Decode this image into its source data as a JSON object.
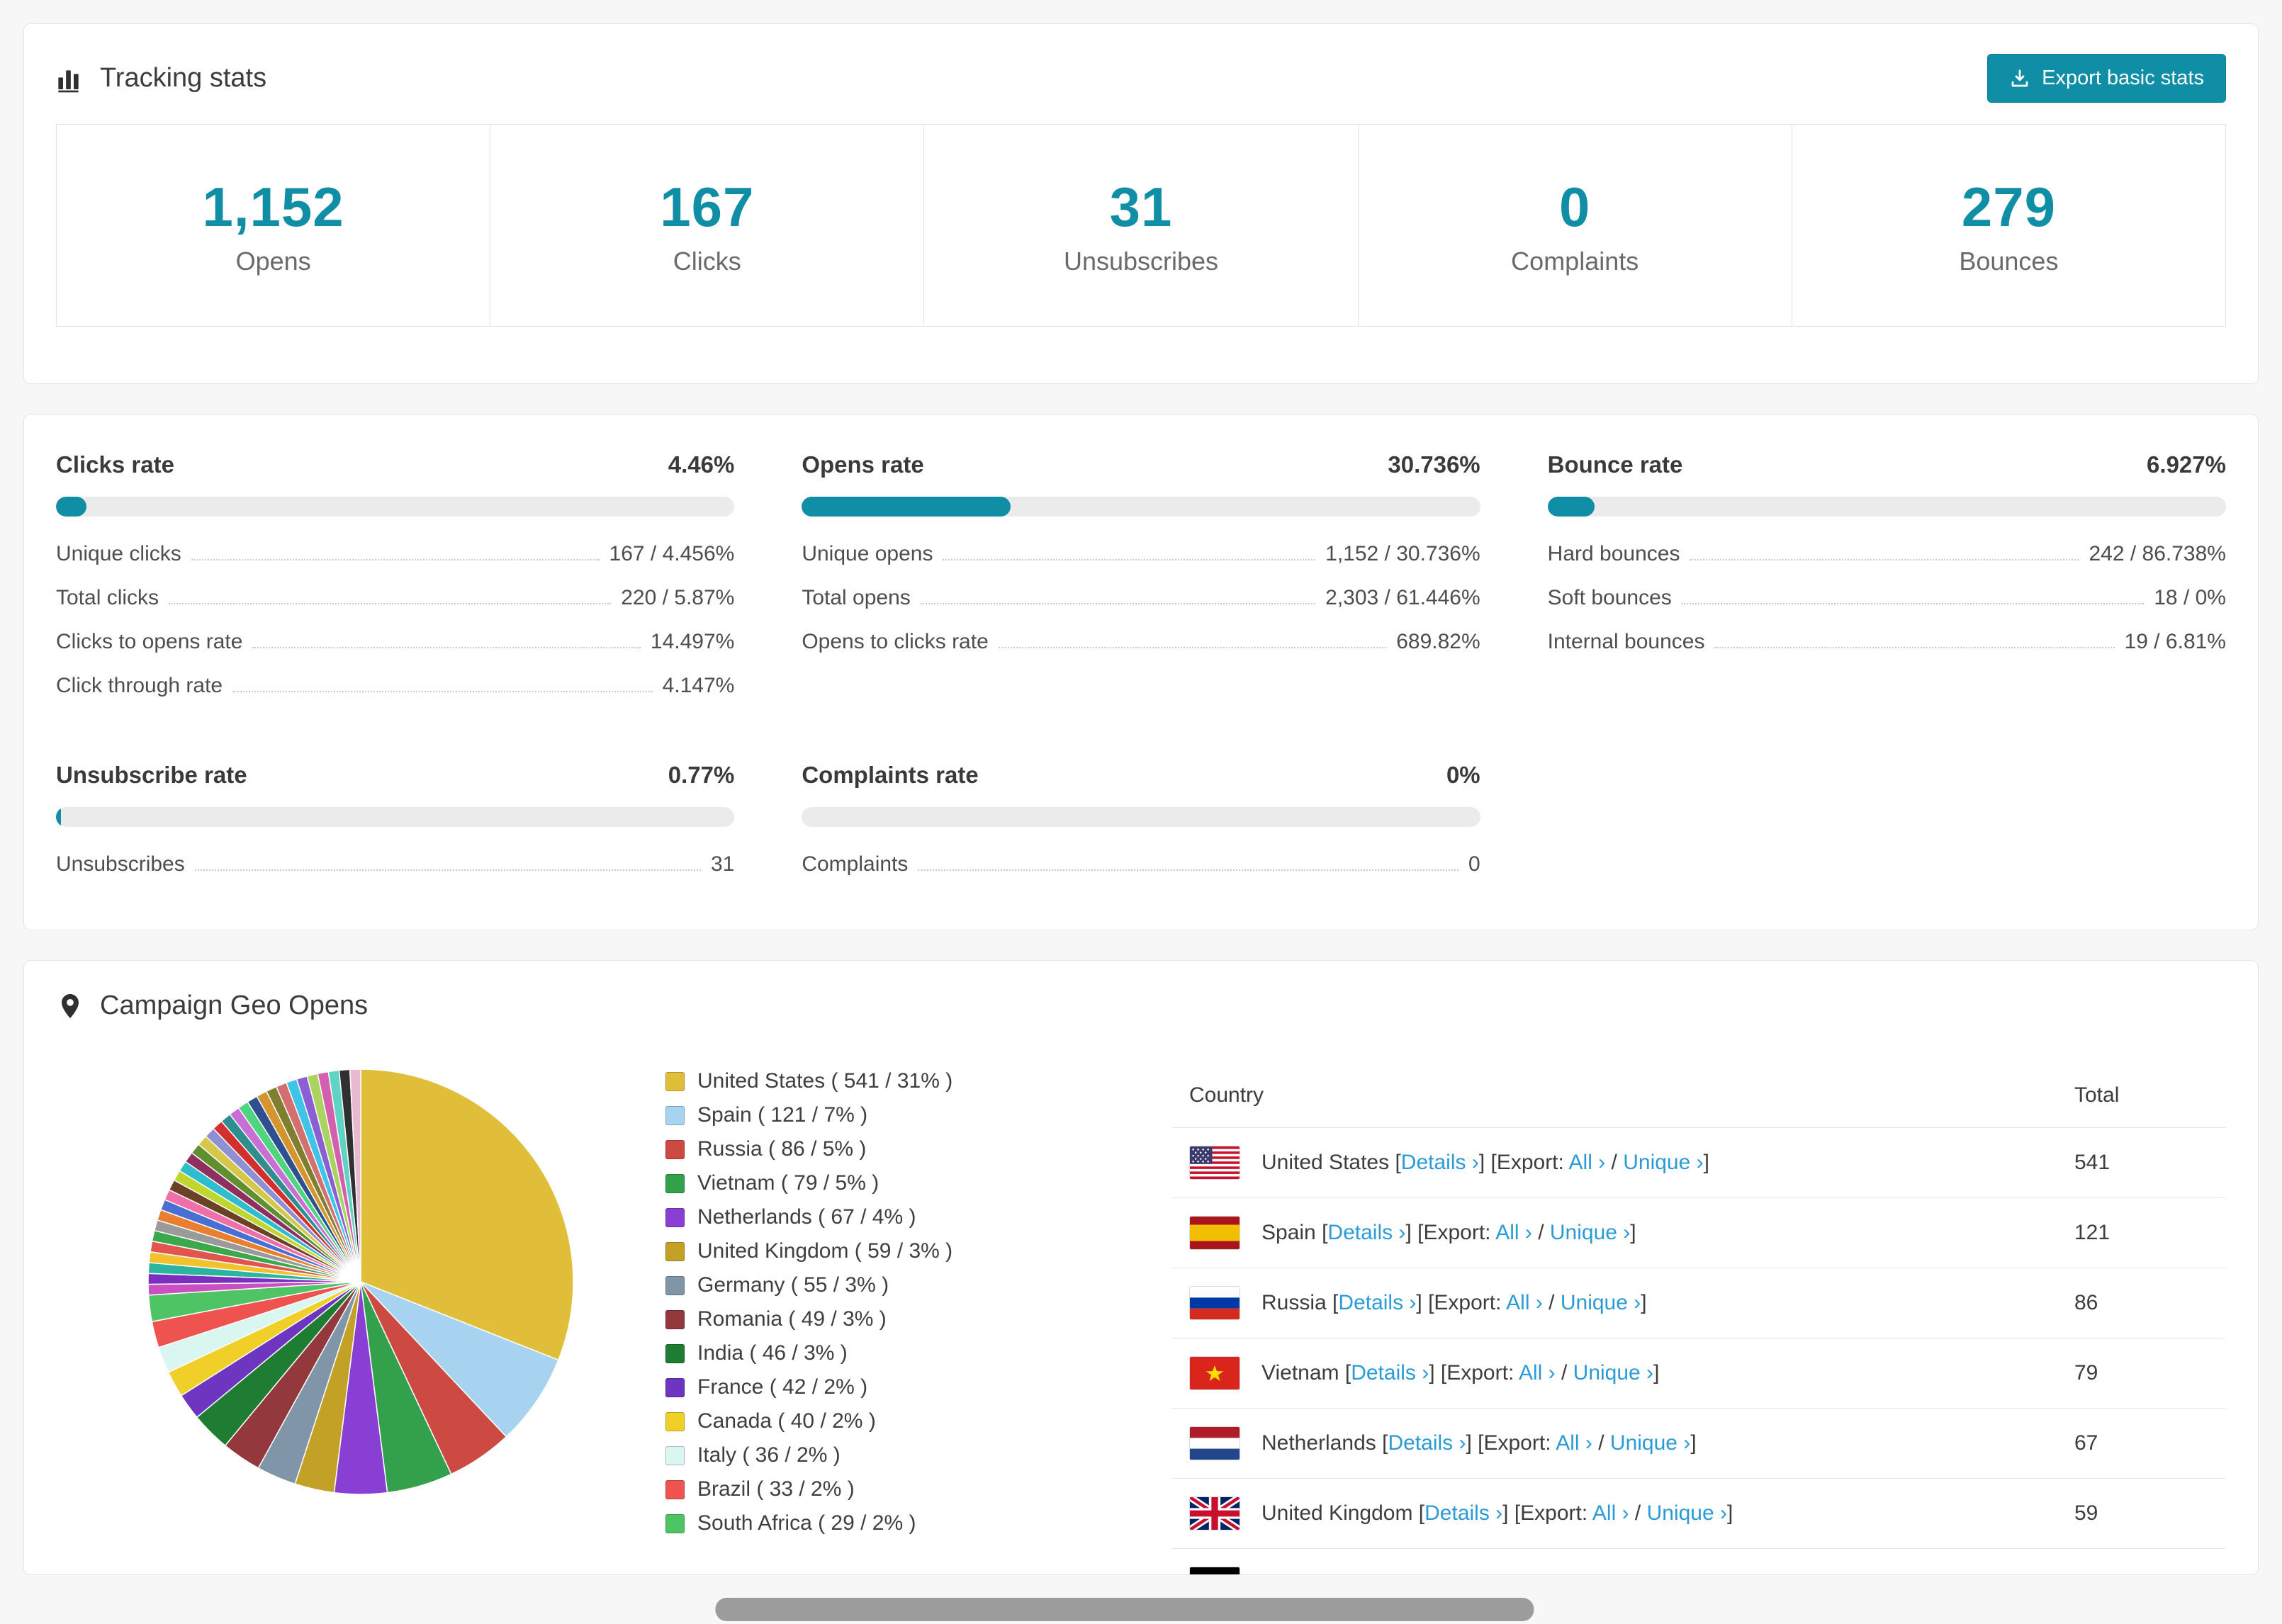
{
  "page": {
    "background": "#f7f7f7",
    "accent_color": "#0f8ea6",
    "link_color": "#2b9bd7"
  },
  "tracking": {
    "title": "Tracking stats",
    "export_button": "Export basic stats",
    "stats": [
      {
        "value": "1,152",
        "label": "Opens"
      },
      {
        "value": "167",
        "label": "Clicks"
      },
      {
        "value": "31",
        "label": "Unsubscribes"
      },
      {
        "value": "0",
        "label": "Complaints"
      },
      {
        "value": "279",
        "label": "Bounces"
      }
    ]
  },
  "rates": [
    {
      "title": "Clicks rate",
      "value": "4.46%",
      "pct": 4.46,
      "rows": [
        {
          "label": "Unique clicks",
          "value": "167 / 4.456%"
        },
        {
          "label": "Total clicks",
          "value": "220 / 5.87%"
        },
        {
          "label": "Clicks to opens rate",
          "value": "14.497%"
        },
        {
          "label": "Click through rate",
          "value": "4.147%"
        }
      ]
    },
    {
      "title": "Opens rate",
      "value": "30.736%",
      "pct": 30.736,
      "rows": [
        {
          "label": "Unique opens",
          "value": "1,152 / 30.736%"
        },
        {
          "label": "Total opens",
          "value": "2,303 / 61.446%"
        },
        {
          "label": "Opens to clicks rate",
          "value": "689.82%"
        }
      ]
    },
    {
      "title": "Bounce rate",
      "value": "6.927%",
      "pct": 6.927,
      "rows": [
        {
          "label": "Hard bounces",
          "value": "242 / 86.738%"
        },
        {
          "label": "Soft bounces",
          "value": "18 / 0%"
        },
        {
          "label": "Internal bounces",
          "value": "19 / 6.81%"
        }
      ]
    },
    {
      "title": "Unsubscribe rate",
      "value": "0.77%",
      "pct": 0.77,
      "rows": [
        {
          "label": "Unsubscribes",
          "value": "31"
        }
      ]
    },
    {
      "title": "Complaints rate",
      "value": "0%",
      "pct": 0,
      "rows": [
        {
          "label": "Complaints",
          "value": "0"
        }
      ]
    }
  ],
  "geo": {
    "title": "Campaign Geo Opens",
    "table": {
      "country_header": "Country",
      "total_header": "Total",
      "visible_rows": 7
    },
    "links": {
      "details": "Details",
      "export_prefix": "Export:",
      "all": "All",
      "unique": "Unique",
      "chevron": "›"
    }
  },
  "chart_data": {
    "type": "pie",
    "title": "Campaign Geo Opens",
    "unit": "opens",
    "legend_position": "right",
    "slices": [
      {
        "label": "United States",
        "value": 541,
        "percent": 31,
        "color": "#e0be3a",
        "flag": "us"
      },
      {
        "label": "Spain",
        "value": 121,
        "percent": 7,
        "color": "#a8d3f0",
        "flag": "es"
      },
      {
        "label": "Russia",
        "value": 86,
        "percent": 5,
        "color": "#cc4a42",
        "flag": "ru"
      },
      {
        "label": "Vietnam",
        "value": 79,
        "percent": 5,
        "color": "#33a04c",
        "flag": "vn"
      },
      {
        "label": "Netherlands",
        "value": 67,
        "percent": 4,
        "color": "#8a3fd4",
        "flag": "nl"
      },
      {
        "label": "United Kingdom",
        "value": 59,
        "percent": 3,
        "color": "#c2a126",
        "flag": "gb"
      },
      {
        "label": "Germany",
        "value": 55,
        "percent": 3,
        "color": "#8096a8",
        "flag": "de"
      },
      {
        "label": "Romania",
        "value": 49,
        "percent": 3,
        "color": "#93383c",
        "flag": "ro"
      },
      {
        "label": "India",
        "value": 46,
        "percent": 3,
        "color": "#1e7c33",
        "flag": "in"
      },
      {
        "label": "France",
        "value": 42,
        "percent": 2,
        "color": "#6d35c0",
        "flag": "fr"
      },
      {
        "label": "Canada",
        "value": 40,
        "percent": 2,
        "color": "#f0d028",
        "flag": "ca"
      },
      {
        "label": "Italy",
        "value": 36,
        "percent": 2,
        "color": "#d9f6f0",
        "flag": "it"
      },
      {
        "label": "Brazil",
        "value": 33,
        "percent": 2,
        "color": "#ef5350",
        "flag": "br"
      },
      {
        "label": "South Africa",
        "value": 29,
        "percent": 2,
        "color": "#4ec464",
        "flag": "za"
      }
    ],
    "others_percent": 26
  }
}
